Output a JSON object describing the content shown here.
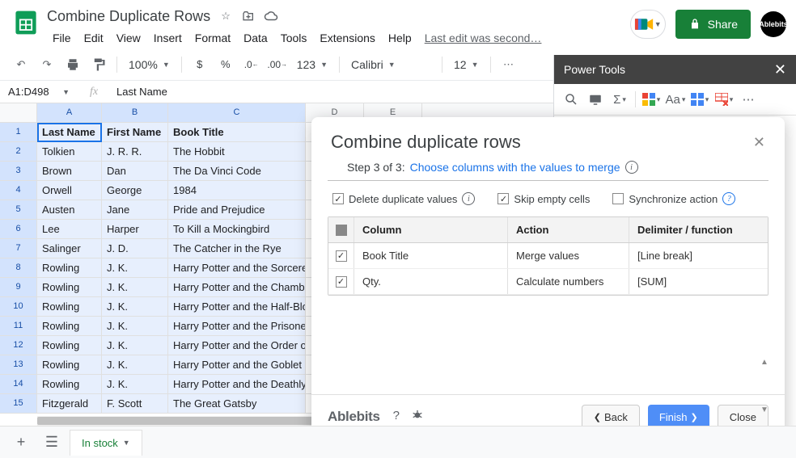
{
  "header": {
    "doc_title": "Combine Duplicate Rows",
    "menus": [
      "File",
      "Edit",
      "View",
      "Insert",
      "Format",
      "Data",
      "Tools",
      "Extensions",
      "Help"
    ],
    "last_edit": "Last edit was second…",
    "share_label": "Share",
    "avatar_label": "Ablebits"
  },
  "toolbar": {
    "zoom": "100%",
    "number_fmt": "123",
    "font": "Calibri",
    "font_size": "12"
  },
  "formula_bar": {
    "name_box": "A1:D498",
    "fx": "fx",
    "value": "Last Name"
  },
  "columns": [
    "A",
    "B",
    "C",
    "D",
    "E"
  ],
  "header_row": [
    "Last Name",
    "First Name",
    "Book Title"
  ],
  "rows": [
    [
      "Tolkien",
      "J. R. R.",
      "The Hobbit"
    ],
    [
      "Brown",
      "Dan",
      "The Da Vinci Code"
    ],
    [
      "Orwell",
      "George",
      "1984"
    ],
    [
      "Austen",
      "Jane",
      "Pride and Prejudice"
    ],
    [
      "Lee",
      "Harper",
      "To Kill a Mockingbird"
    ],
    [
      "Salinger",
      "J. D.",
      "The Catcher in the Rye"
    ],
    [
      "Rowling",
      "J. K.",
      "Harry Potter and the Sorcerer's Stone"
    ],
    [
      "Rowling",
      "J. K.",
      "Harry Potter and the Chamber of Secrets"
    ],
    [
      "Rowling",
      "J. K.",
      "Harry Potter and the Half-Blood Prince"
    ],
    [
      "Rowling",
      "J. K.",
      "Harry Potter and the Prisoner of Azkaban"
    ],
    [
      "Rowling",
      "J. K.",
      "Harry Potter and the Order of the Phoenix"
    ],
    [
      "Rowling",
      "J. K.",
      "Harry Potter and the Goblet of Fire"
    ],
    [
      "Rowling",
      "J. K.",
      "Harry Potter and the Deathly Hallows"
    ],
    [
      "Fitzgerald",
      "F. Scott",
      "The Great Gatsby"
    ]
  ],
  "sidebar": {
    "title": "Power Tools"
  },
  "panel": {
    "title": "Combine duplicate rows",
    "step_prefix": "Step 3 of 3:",
    "step_link": "Choose columns with the values to merge",
    "opt_delete": "Delete duplicate values",
    "opt_skip": "Skip empty cells",
    "opt_sync": "Synchronize action",
    "th_column": "Column",
    "th_action": "Action",
    "th_delim": "Delimiter / function",
    "rows": [
      {
        "col": "Book Title",
        "action": "Merge values",
        "delim": "[Line break]"
      },
      {
        "col": "Qty.",
        "action": "Calculate numbers",
        "delim": "[SUM]"
      }
    ],
    "footer_brand": "Ablebits",
    "btn_back": "Back",
    "btn_finish": "Finish",
    "btn_close": "Close"
  },
  "tabs": {
    "sheet1": "In stock"
  }
}
